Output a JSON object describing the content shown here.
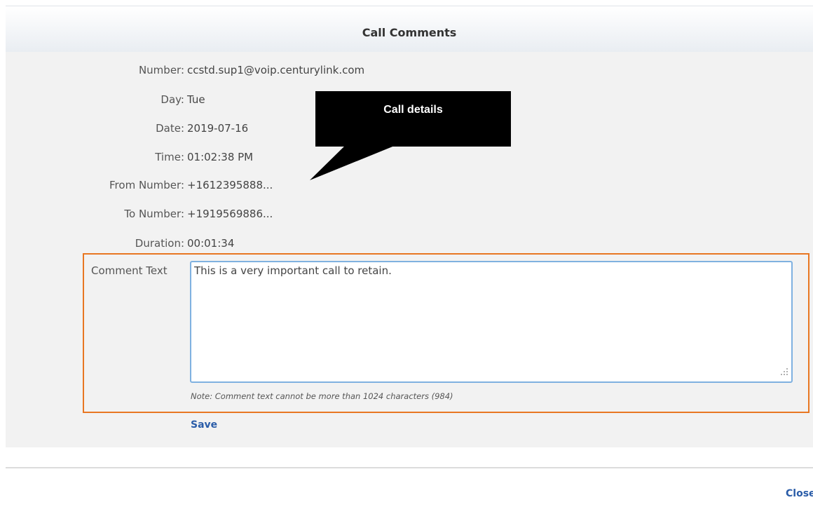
{
  "dialog": {
    "title": "Call Comments"
  },
  "fields": [
    {
      "label": "Number:",
      "value": "ccstd.sup1@voip.centurylink.com"
    },
    {
      "label": "Day:",
      "value": "Tue"
    },
    {
      "label": "Date:",
      "value": "2019-07-16"
    },
    {
      "label": "Time:",
      "value": "01:02:38 PM"
    },
    {
      "label": "From Number:",
      "value": "+1612395888..."
    },
    {
      "label": "To Number:",
      "value": "+1919569886..."
    },
    {
      "label": "Duration:",
      "value": "00:01:34"
    }
  ],
  "callout": {
    "text": "Call details"
  },
  "comment": {
    "label": "Comment Text",
    "value": "This is a very important call to retain.",
    "note": "Note: Comment text cannot be more than 1024 characters (984)"
  },
  "actions": {
    "save_label": "Save",
    "close_label": "Close"
  },
  "colors": {
    "highlight": "#e87722",
    "link": "#2a5ca8",
    "callout_bg": "#000000",
    "panel_bg": "#f2f2f2"
  }
}
